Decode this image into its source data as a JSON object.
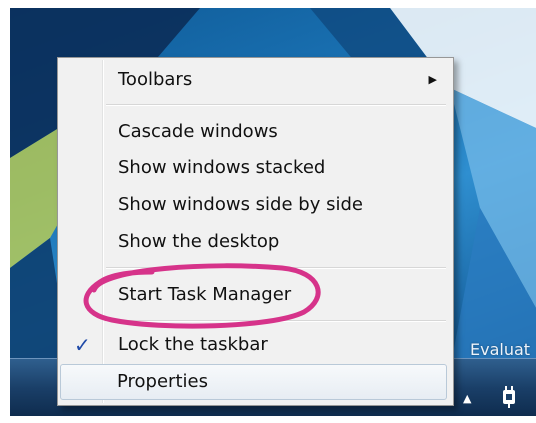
{
  "context_menu": {
    "toolbars": "Toolbars",
    "cascade": "Cascade windows",
    "stacked": "Show windows stacked",
    "side_by_side": "Show windows side by side",
    "show_desktop": "Show the desktop",
    "task_manager": "Start Task Manager",
    "lock_taskbar": "Lock the taskbar",
    "properties": "Properties"
  },
  "desktop": {
    "watermark": "Evaluat"
  },
  "icons": {
    "submenu": "chevron-right-icon",
    "check": "checkmark-icon",
    "tray_expand": "chevron-up-icon",
    "tray_app": "power-plug-icon"
  },
  "colors": {
    "annotation": "#d6338a",
    "check": "#1f4aa8"
  }
}
